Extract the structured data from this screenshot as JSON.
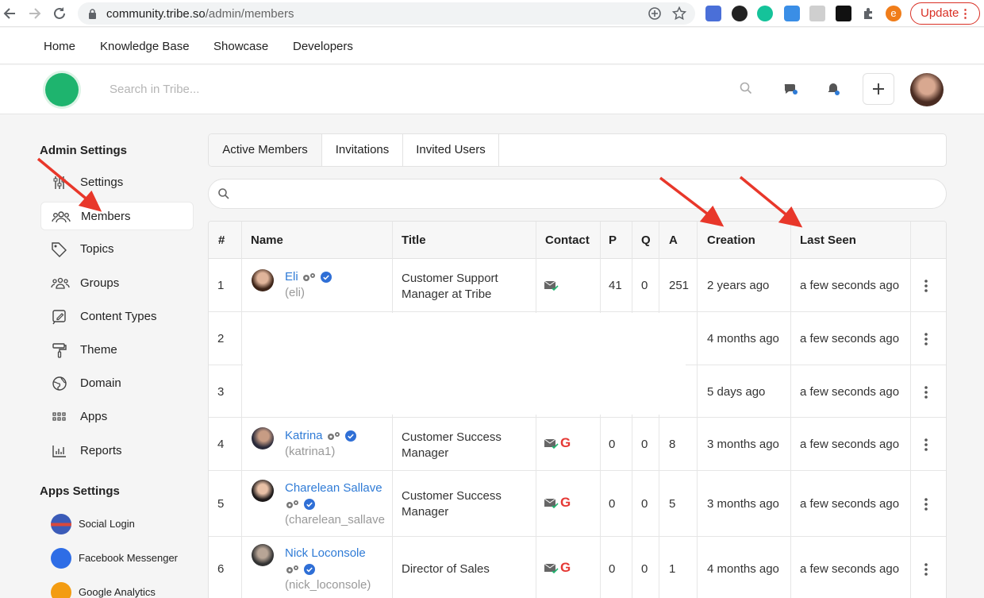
{
  "browser": {
    "url_host": "community.tribe.so",
    "url_path": "/admin/members",
    "update_label": "Update",
    "profile_letter": "e"
  },
  "topnav": [
    "Home",
    "Knowledge Base",
    "Showcase",
    "Developers"
  ],
  "header": {
    "search_placeholder": "Search in Tribe..."
  },
  "sidebar": {
    "admin_title": "Admin Settings",
    "items": [
      {
        "label": "Settings",
        "icon": "sliders-icon"
      },
      {
        "label": "Members",
        "icon": "users-icon",
        "active": true
      },
      {
        "label": "Topics",
        "icon": "tag-icon"
      },
      {
        "label": "Groups",
        "icon": "groups-icon"
      },
      {
        "label": "Content Types",
        "icon": "edit-icon"
      },
      {
        "label": "Theme",
        "icon": "paint-roller-icon"
      },
      {
        "label": "Domain",
        "icon": "globe-icon"
      },
      {
        "label": "Apps",
        "icon": "apps-grid-icon"
      },
      {
        "label": "Reports",
        "icon": "bar-chart-icon"
      }
    ],
    "apps_title": "Apps Settings",
    "apps": [
      {
        "label": "Social Login",
        "color": "#3b5bb8"
      },
      {
        "label": "Facebook Messenger",
        "color": "#2e6de6"
      },
      {
        "label": "Google Analytics",
        "color": "#f39c12"
      }
    ]
  },
  "tabs": [
    "Active Members",
    "Invitations",
    "Invited Users"
  ],
  "table": {
    "headers": [
      "#",
      "Name",
      "Title",
      "Contact",
      "P",
      "Q",
      "A",
      "Creation",
      "Last Seen"
    ],
    "rows": [
      {
        "num": "1",
        "name": "Eli",
        "handle": "(eli)",
        "title1": "Customer Support",
        "title2": "Manager at Tribe",
        "p": "41",
        "q": "0",
        "a": "251",
        "creation": "2 years ago",
        "last_seen": "a few seconds ago",
        "google": false
      },
      {
        "num": "2",
        "name": "",
        "handle": "",
        "title1": "",
        "title2": "",
        "p": "",
        "q": "",
        "a": "",
        "creation": "4 months ago",
        "last_seen": "a few seconds ago",
        "google": false
      },
      {
        "num": "3",
        "name": "",
        "handle": "",
        "title1": "",
        "title2": "",
        "p": "",
        "q": "",
        "a": "",
        "creation": "5 days ago",
        "last_seen": "a few seconds ago",
        "google": false
      },
      {
        "num": "4",
        "name": "Katrina",
        "handle": "(katrina1)",
        "title1": "Customer Success",
        "title2": "Manager",
        "p": "0",
        "q": "0",
        "a": "8",
        "creation": "3 months ago",
        "last_seen": "a few seconds ago",
        "google": true
      },
      {
        "num": "5",
        "name": "Charelean Sallave",
        "handle": "(charelean_sallave",
        "title1": "Customer Success",
        "title2": "Manager",
        "p": "0",
        "q": "0",
        "a": "5",
        "creation": "3 months ago",
        "last_seen": "a few seconds ago",
        "google": true
      },
      {
        "num": "6",
        "name": "Nick Loconsole",
        "handle": "(nick_loconsole)",
        "title1": "Director of Sales",
        "title2": "",
        "p": "0",
        "q": "0",
        "a": "1",
        "creation": "4 months ago",
        "last_seen": "a few seconds ago",
        "google": true
      }
    ]
  },
  "colors": {
    "accent": "#2f7bd6",
    "brand": "#1eb46e",
    "arrow": "#e8372a",
    "google": "#e53935"
  }
}
